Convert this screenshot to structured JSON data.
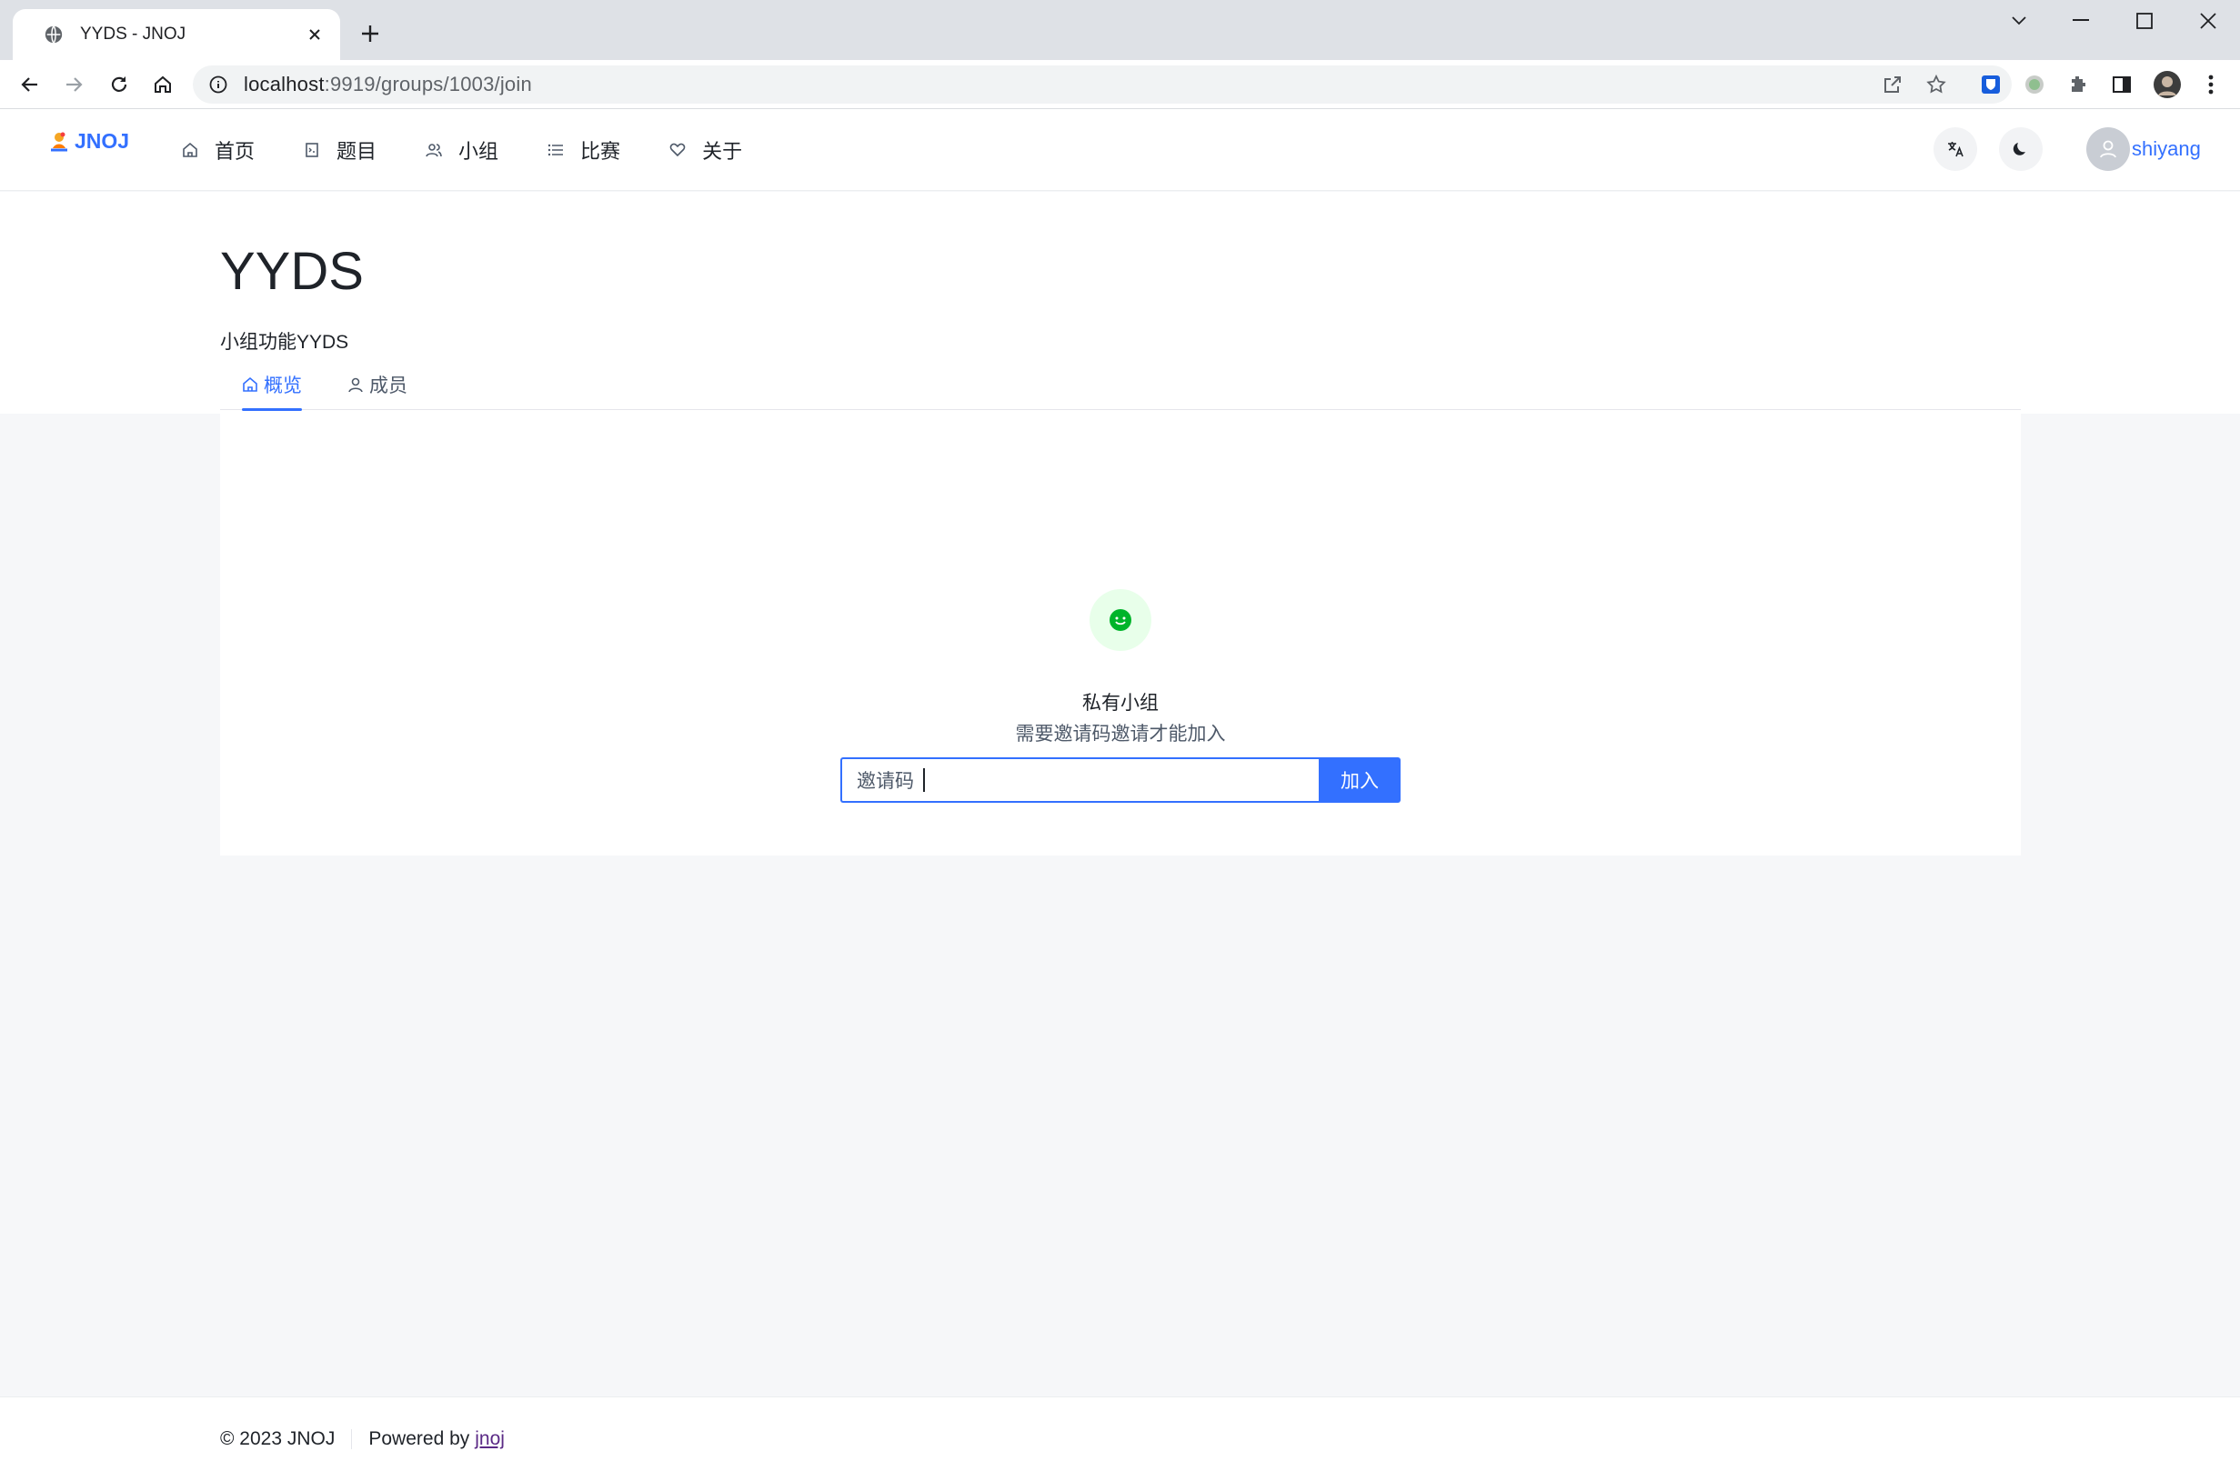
{
  "browser": {
    "tab_title": "YYDS - JNOJ",
    "url_host": "localhost",
    "url_path": ":9919/groups/1003/join"
  },
  "nav": {
    "logo_text": "JNOJ",
    "items": [
      {
        "label": "首页",
        "icon": "home-icon"
      },
      {
        "label": "题目",
        "icon": "problem-icon"
      },
      {
        "label": "小组",
        "icon": "group-icon"
      },
      {
        "label": "比赛",
        "icon": "list-icon"
      },
      {
        "label": "关于",
        "icon": "heart-icon"
      }
    ],
    "username": "shiyang"
  },
  "group": {
    "title": "YYDS",
    "description": "小组功能YYDS"
  },
  "tabs": [
    {
      "label": "概览",
      "icon": "home-icon",
      "active": true
    },
    {
      "label": "成员",
      "icon": "user-icon",
      "active": false
    }
  ],
  "result": {
    "icon": "smile-icon",
    "title": "私有小组",
    "subtitle": "需要邀请码邀请才能加入"
  },
  "join_form": {
    "prefix_label": "邀请码",
    "value": "",
    "button_label": "加入"
  },
  "footer": {
    "copyright": "© 2023 JNOJ",
    "powered_by": "Powered by",
    "powered_link": "jnoj"
  },
  "colors": {
    "primary": "#3370ff",
    "success_bg": "#e8ffea",
    "success": "#00b42a"
  }
}
